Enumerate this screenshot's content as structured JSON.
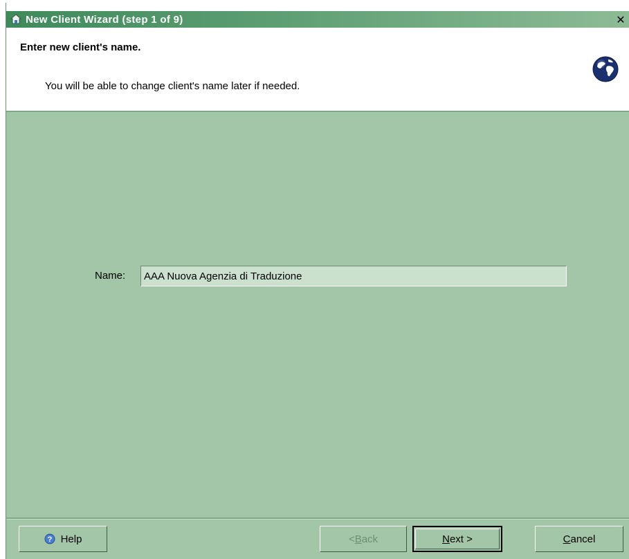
{
  "window": {
    "title": "New Client Wizard  (step 1 of 9)",
    "close_glyph": "✕"
  },
  "header": {
    "heading": "Enter new client's name.",
    "subtext": "You will be able to change client's name later if needed.",
    "icon": "globe-icon"
  },
  "form": {
    "name_label": "Name:",
    "name_value": "AAA Nuova Agenzia di Traduzione"
  },
  "buttons": {
    "help": {
      "label": "Help",
      "icon": "help-icon"
    },
    "back": {
      "label_pre": "< ",
      "mnemonic": "B",
      "label_post": "ack",
      "enabled": false
    },
    "next": {
      "mnemonic": "N",
      "label_post": "ext >"
    },
    "cancel": {
      "mnemonic": "C",
      "label_post": "ancel"
    }
  },
  "colors": {
    "panel": "#a3c6a8",
    "titlebar": "#3f8a5c",
    "input_bg": "#cbe0cd"
  }
}
